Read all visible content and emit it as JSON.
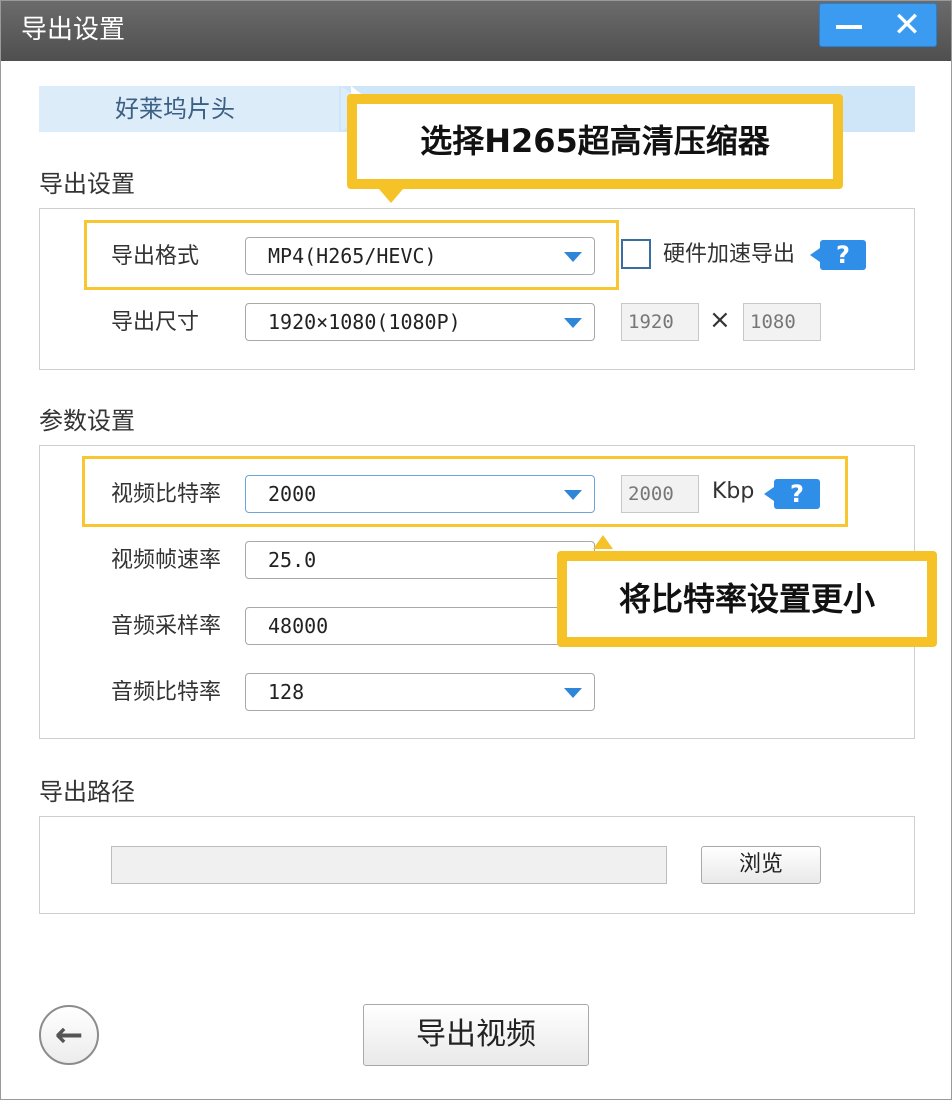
{
  "window": {
    "title": "导出设置",
    "controls": {
      "minimize_icon": "minimize-icon",
      "close_label": "✕"
    }
  },
  "tabs": [
    {
      "label": "好莱坞片头"
    }
  ],
  "annotations": {
    "callout_top": "选择H265超高清压缩器",
    "callout_bottom": "将比特率设置更小",
    "highlight_color": "#f5c227"
  },
  "export_settings": {
    "section_title": "导出设置",
    "format": {
      "label": "导出格式",
      "value": "MP4(H265/HEVC)"
    },
    "hardware_accel": {
      "label": "硬件加速导出",
      "checked": false,
      "help": "?"
    },
    "size": {
      "label": "导出尺寸",
      "value": "1920×1080(1080P)",
      "width": "1920",
      "times": "×",
      "height": "1080"
    }
  },
  "param_settings": {
    "section_title": "参数设置",
    "video_bitrate": {
      "label": "视频比特率",
      "value": "2000",
      "readout": "2000",
      "unit": "Kbp",
      "help": "?"
    },
    "frame_rate": {
      "label": "视频帧速率",
      "value": "25.0"
    },
    "audio_sample": {
      "label": "音频采样率",
      "value": "48000"
    },
    "audio_bitrate": {
      "label": "音频比特率",
      "value": "128"
    }
  },
  "export_path": {
    "section_title": "导出路径",
    "path_value": "",
    "browse_label": "浏览"
  },
  "footer": {
    "back_icon": "back-arrow-icon",
    "export_label": "导出视频"
  },
  "colors": {
    "accent": "#2f8fe8",
    "titlebar": "#555555",
    "tab_bg": "#dcecf9"
  }
}
